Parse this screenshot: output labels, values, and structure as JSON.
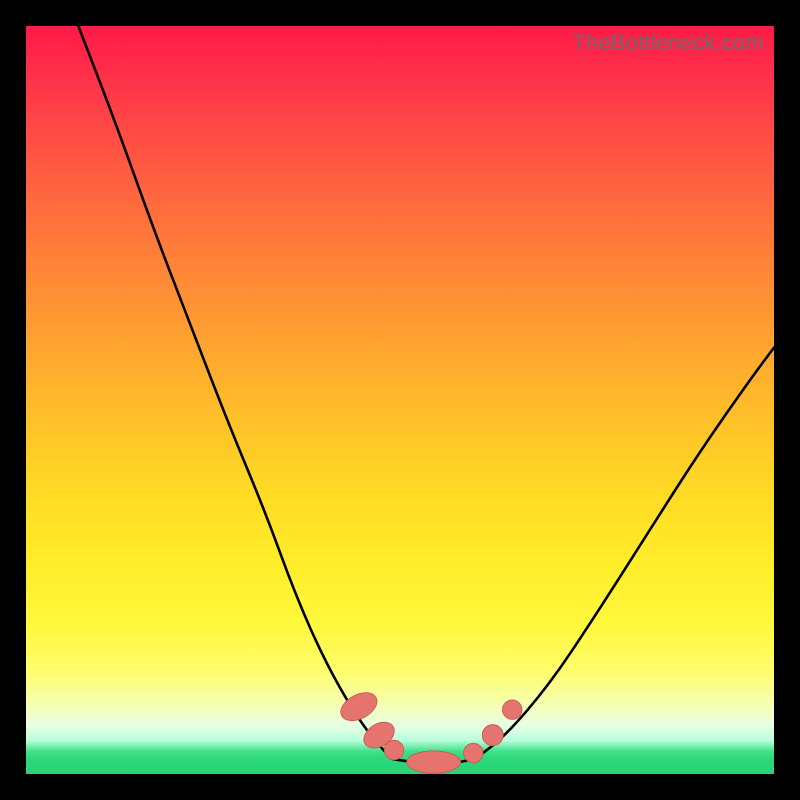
{
  "watermark": "TheBottleneck.com",
  "colors": {
    "frame_bg": "#000000",
    "gradient_top": "#ff1a47",
    "gradient_mid": "#ffdc24",
    "gradient_bottom": "#25d475",
    "curve_stroke": "#000000",
    "marker_fill": "#e4746d",
    "marker_stroke": "#c95a53"
  },
  "chart_data": {
    "type": "line",
    "title": "",
    "xlabel": "",
    "ylabel": "",
    "xlim": [
      0,
      100
    ],
    "ylim": [
      0,
      100
    ],
    "grid": false,
    "legend": false,
    "series": [
      {
        "name": "left-branch",
        "x": [
          7,
          12,
          17,
          22,
          27,
          32,
          36,
          40,
          44,
          47,
          49
        ],
        "y": [
          100,
          87,
          73,
          60,
          47,
          35,
          24,
          15,
          8,
          4,
          2
        ]
      },
      {
        "name": "trough",
        "x": [
          49,
          53,
          57,
          60
        ],
        "y": [
          2,
          1.4,
          1.4,
          2
        ]
      },
      {
        "name": "right-branch",
        "x": [
          60,
          64,
          70,
          76,
          83,
          90,
          97,
          100
        ],
        "y": [
          2,
          5,
          12,
          21,
          32,
          43,
          53,
          57
        ]
      }
    ],
    "markers": [
      {
        "shape": "pill",
        "cx": 44.5,
        "cy": 9.0,
        "rx": 1.6,
        "ry": 2.6,
        "rot": 62
      },
      {
        "shape": "pill",
        "cx": 47.2,
        "cy": 5.2,
        "rx": 1.5,
        "ry": 2.2,
        "rot": 58
      },
      {
        "shape": "dot",
        "cx": 49.2,
        "cy": 3.2,
        "r": 1.3
      },
      {
        "shape": "pill",
        "cx": 54.5,
        "cy": 1.6,
        "rx": 3.6,
        "ry": 1.5,
        "rot": 0
      },
      {
        "shape": "dot",
        "cx": 59.8,
        "cy": 2.8,
        "r": 1.3
      },
      {
        "shape": "dot",
        "cx": 62.4,
        "cy": 5.2,
        "r": 1.4
      },
      {
        "shape": "dot",
        "cx": 65.0,
        "cy": 8.6,
        "r": 1.3
      }
    ]
  }
}
